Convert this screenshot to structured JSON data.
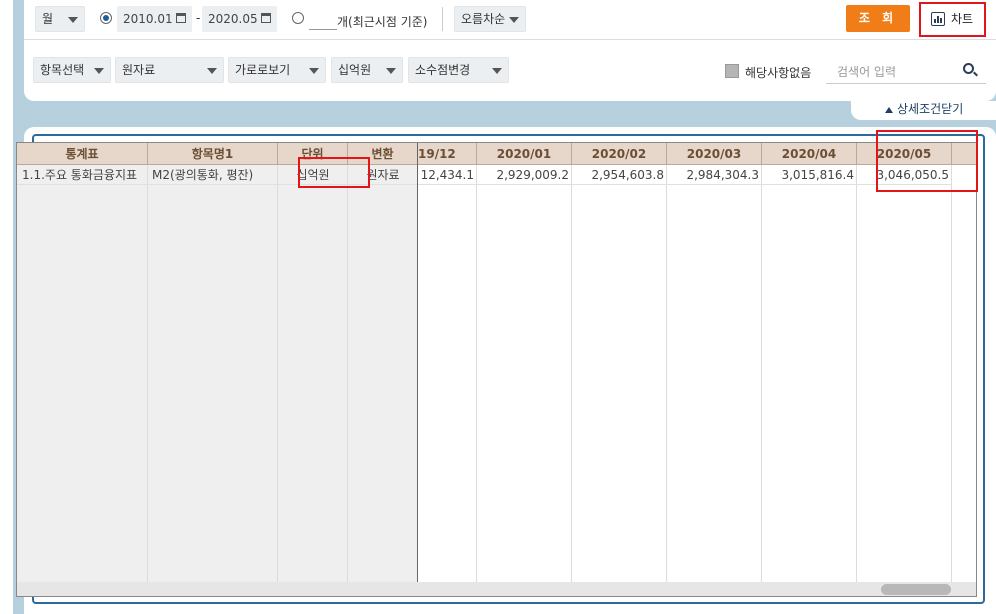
{
  "filters": {
    "period_unit": "월",
    "date_from": "2010.01",
    "date_sep": "-",
    "date_to": "2020.05",
    "recent_label": "개(최근시점 기준)",
    "sort": "오름차순",
    "query_button": "조 회",
    "chart_button": "차트"
  },
  "options": {
    "item_select": "항목선택",
    "raw_data": "원자료",
    "horizontal_view": "가로로보기",
    "unit": "십억원",
    "decimal_change": "소수점변경",
    "no_match_label": "해당사항없음",
    "search_placeholder": "검색어 입력",
    "collapse_label": "상세조건닫기"
  },
  "table": {
    "headers": [
      "통계표",
      "항목명1",
      "단위",
      "변환",
      "19/12",
      "2020/01",
      "2020/02",
      "2020/03",
      "2020/04",
      "2020/05"
    ],
    "rows": [
      {
        "stat_table": "1.1.주요 통화금융지표",
        "item": "M2(광의통화, 평잔)",
        "unit": "십억원",
        "transform": "원자료",
        "values": [
          "12,434.1",
          "2,929,009.2",
          "2,954,603.8",
          "2,984,304.3",
          "3,015,816.4",
          "3,046,050.5"
        ]
      }
    ]
  },
  "colors": {
    "accent_orange": "#f07d17",
    "highlight_red": "#e0161b",
    "header_bg": "#e6d7ca",
    "frame_blue": "#2b6a9a",
    "backdrop": "#b7d0dd"
  }
}
